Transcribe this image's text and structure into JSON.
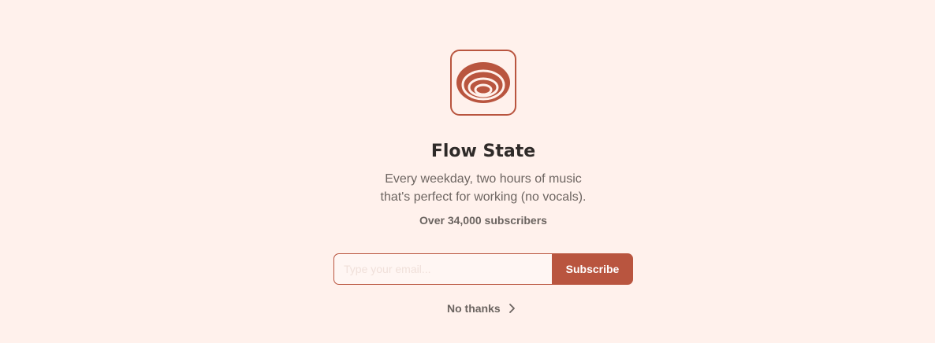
{
  "publication": {
    "title": "Flow State",
    "description_line1": "Every weekday, two hours of music",
    "description_line2": "that's perfect for working (no vocals).",
    "subscriber_count": "Over 34,000 subscribers",
    "logo_icon": "concentric-rings-icon"
  },
  "form": {
    "email_placeholder": "Type your email...",
    "email_value": "",
    "subscribe_label": "Subscribe"
  },
  "footer": {
    "no_thanks_label": "No thanks",
    "chevron_icon": "chevron-right-icon"
  },
  "colors": {
    "background": "#fff1ec",
    "accent": "#b9553f",
    "title": "#2e2a28",
    "muted_text": "#6d6561"
  }
}
